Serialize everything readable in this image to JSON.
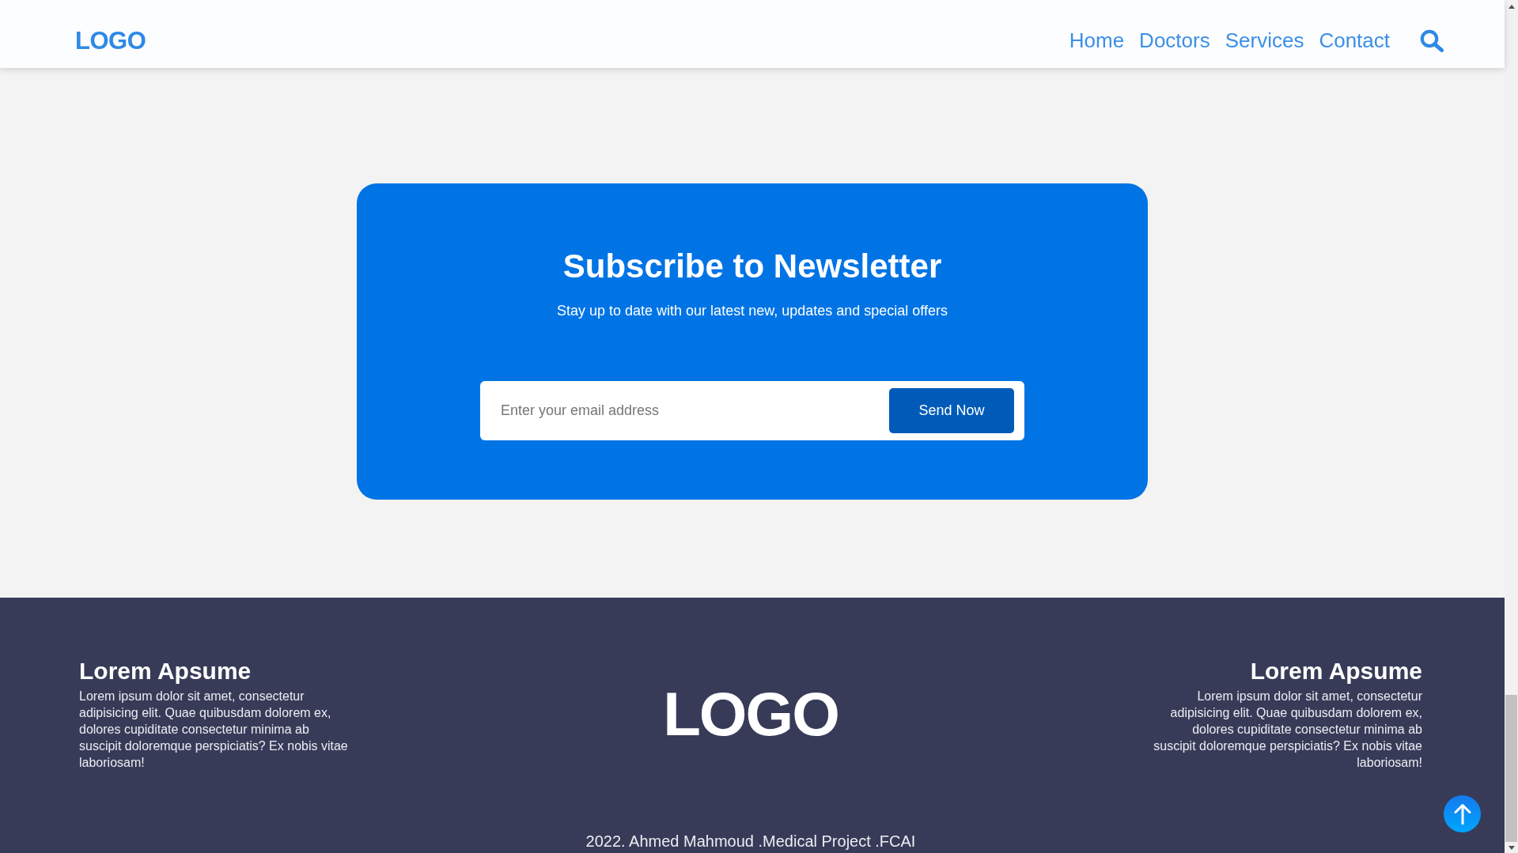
{
  "header": {
    "logo": "LOGO",
    "nav": [
      "Home",
      "Doctors",
      "Services",
      "Contact"
    ]
  },
  "newsletter": {
    "title": "Subscribe to Newsletter",
    "subtitle": "Stay up to date with our latest new, updates and special offers",
    "email_field": {
      "placeholder": "Enter your email address"
    },
    "button": "Send Now"
  },
  "footer": {
    "left_column": {
      "heading": "Lorem Apsume",
      "text": "Lorem ipsum dolor sit amet, consectetur adipisicing elit. Quae quibusdam dolorem ex, dolores cupiditate consectetur minima ab suscipit doloremque perspiciatis? Ex nobis vitae laboriosam!"
    },
    "logo": "LOGO",
    "right_column": {
      "heading": "Lorem Apsume",
      "text": "Lorem ipsum dolor sit amet, consectetur adipisicing elit. Quae quibusdam dolorem ex, dolores cupiditate consectetur minima ab suscipit doloremque perspiciatis? Ex nobis vitae laboriosam!"
    },
    "copyright": "2022. Ahmed Mahmoud .Medical Project .FCAI"
  }
}
